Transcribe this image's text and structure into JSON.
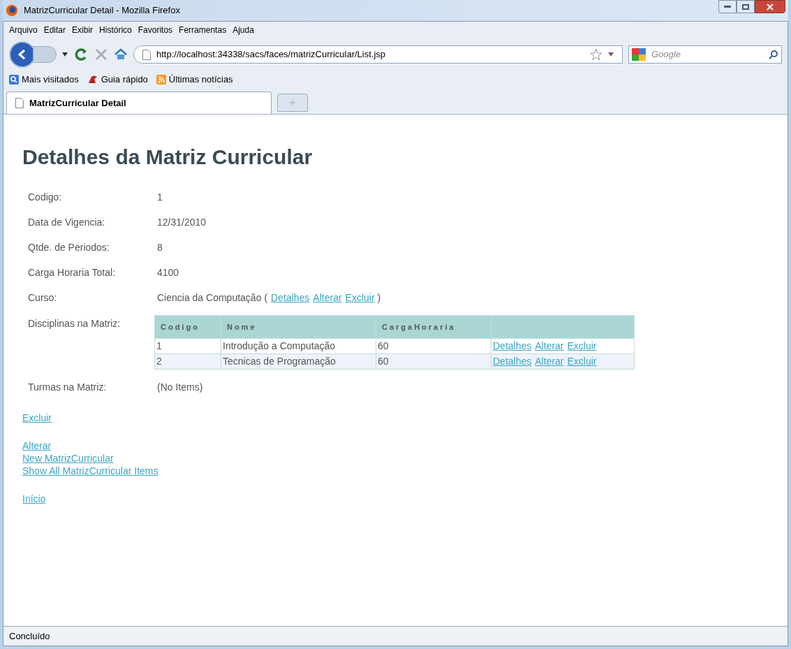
{
  "window": {
    "title": "MatrizCurricular Detail - Mozilla Firefox"
  },
  "menu": [
    "Arquivo",
    "Editar",
    "Exibir",
    "Histórico",
    "Favoritos",
    "Ferramentas",
    "Ajuda"
  ],
  "address_bar": {
    "url": "http://localhost:34338/sacs/faces/matrizCurricular/List.jsp"
  },
  "search": {
    "placeholder": "Google"
  },
  "bookmarks": [
    {
      "label": "Mais visitados",
      "kind": "search"
    },
    {
      "label": "Guia rápido",
      "kind": "guide"
    },
    {
      "label": "Últimas notícias",
      "kind": "rss"
    }
  ],
  "tabs": [
    {
      "label": "MatrizCurricular Detail",
      "selected": true
    }
  ],
  "page": {
    "heading": "Detalhes da Matriz Curricular",
    "fields": [
      {
        "label": "Codigo:",
        "value": "1"
      },
      {
        "label": "Data de Vigencia:",
        "value": "12/31/2010"
      },
      {
        "label": "Qtde. de Periodos:",
        "value": "8"
      },
      {
        "label": "Carga Horaria Total:",
        "value": "4100"
      }
    ],
    "curso": {
      "label": "Curso:",
      "value": "Ciencia da Computação",
      "open": "(",
      "links": [
        "Detalhes",
        "Alterar",
        "Excluir"
      ],
      "close": ")"
    },
    "disciplinas": {
      "label": "Disciplinas na Matriz:",
      "columns": [
        "Codigo",
        "Nome",
        "CargaHoraria"
      ],
      "rows": [
        {
          "cells": [
            "1",
            "Introdução a Computação",
            "60"
          ],
          "actions": [
            "Detalhes",
            "Alterar",
            "Excluir"
          ]
        },
        {
          "cells": [
            "2",
            "Tecnicas de Programação",
            "60"
          ],
          "actions": [
            "Detalhes",
            "Alterar",
            "Excluir"
          ]
        }
      ]
    },
    "turmas": {
      "label": "Turmas na Matriz:",
      "value": "(No Items)"
    },
    "link_groups": [
      [
        "Excluir"
      ],
      [
        "Alterar",
        "New MatrizCurricular",
        "Show All MatrizCurricular Items"
      ],
      [
        "Início"
      ]
    ]
  },
  "status_bar": {
    "text": "Concluído"
  }
}
